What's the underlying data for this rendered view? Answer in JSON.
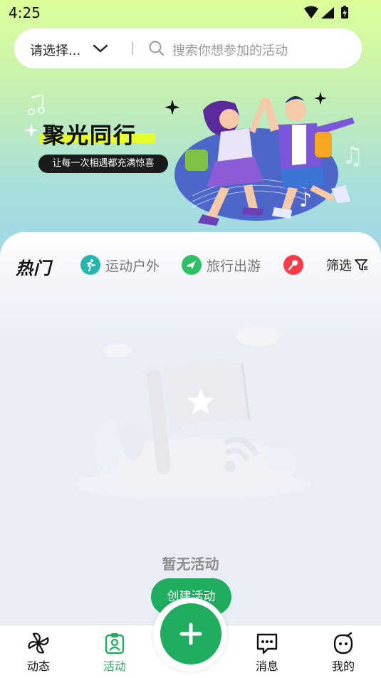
{
  "status": {
    "time": "4:25"
  },
  "search": {
    "city": "请选择...",
    "placeholder": "搜索你想参加的活动"
  },
  "banner": {
    "title": "聚光同行",
    "subtitle": "让每一次相遇都充满惊喜"
  },
  "tabs": {
    "hot": "热门",
    "items": [
      {
        "label": "运动户外",
        "icon": "running-person-icon",
        "color": "#28b5b0"
      },
      {
        "label": "旅行出游",
        "icon": "airplane-icon",
        "color": "#2fbf67"
      },
      {
        "label": "",
        "icon": "microphone-icon",
        "color": "#ff3b48"
      }
    ],
    "filter": "筛选"
  },
  "empty": {
    "text": "暂无活动",
    "create_label": "创建活动"
  },
  "nav": {
    "items": [
      {
        "label": "动态",
        "icon": "pinwheel-icon"
      },
      {
        "label": "活动",
        "icon": "activity-badge-icon",
        "active": true
      },
      {
        "label": "消息",
        "icon": "chat-bubble-icon"
      },
      {
        "label": "我的",
        "icon": "face-icon"
      }
    ],
    "fab_icon": "plus-icon"
  },
  "colors": {
    "accent": "#20ad5f",
    "banner_highlight": "#e4ff2a"
  }
}
